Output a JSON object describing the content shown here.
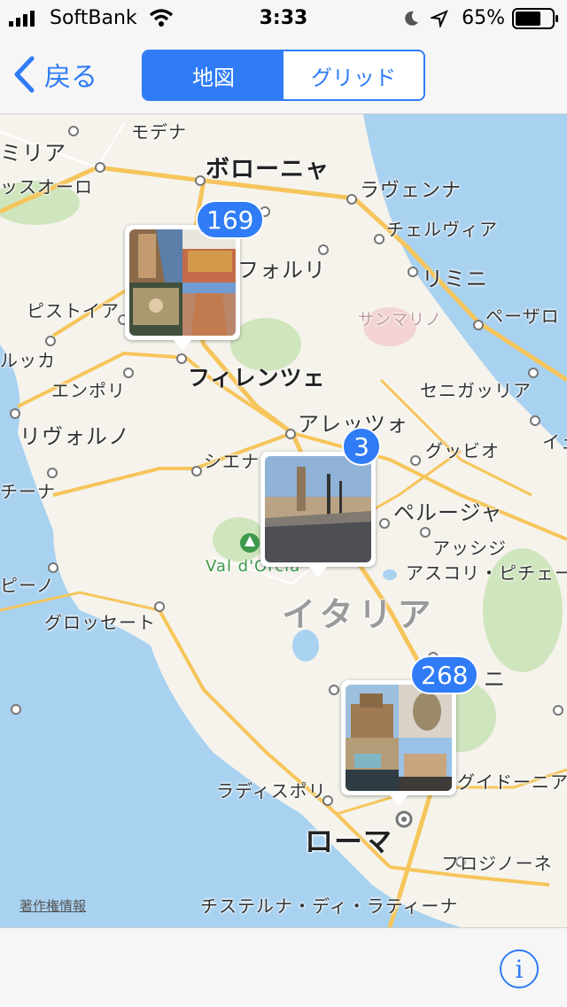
{
  "status": {
    "carrier": "SoftBank",
    "time": "3:33",
    "battery": "65%"
  },
  "nav": {
    "back_label": "戻る",
    "segments": [
      "地図",
      "グリッド"
    ],
    "selected_segment": "地図"
  },
  "map": {
    "labels": {
      "modena": "モデナ",
      "emilia": "ミリア",
      "sassuolo": "ッスオーロ",
      "bologna": "ボローニャ",
      "ravenna": "ラヴェンナ",
      "cervia": "チェルヴィア",
      "forli": "フォルリ",
      "rimini": "リミニ",
      "pistoia": "ピストイア",
      "sanmarino": "サンマリノ",
      "pesaro": "ペーザロ",
      "lucca": "ルッカ",
      "empoli": "エンポリ",
      "firenze": "フィレンツェ",
      "senigallia": "セニガッリア",
      "arezzo": "アレッツォ",
      "livorno": "リヴォルノ",
      "gubbio": "グッビオ",
      "siena": "シエナ",
      "ie": "イェ",
      "cina": "チーナ",
      "perugia": "ペルージャ",
      "assisi": "アッシジ",
      "valdorcia": "Val d'Orcia",
      "ascoli": "アスコリ・ピチェー",
      "pino": "ピーノ",
      "italy": "イタリア",
      "grosseto": "グロッセート",
      "terni": "ニ",
      "guidonia": "グイドーニア",
      "ladispoli": "ラディスポリ",
      "roma": "ローマ",
      "frosinone": "フロジノーネ",
      "cisterna": "チステルナ・ディ・ラティーナ"
    },
    "pins": [
      {
        "count": "169",
        "area": "フィレンツェ"
      },
      {
        "count": "3",
        "area": "Val d'Orcia"
      },
      {
        "count": "268",
        "area": "ローマ"
      }
    ],
    "legal_label": "著作権情報"
  },
  "colors": {
    "accent": "#2f7cf6",
    "sea": "#a9d2f1",
    "land": "#f5f3ec",
    "road": "#f6c55b",
    "park": "#cfe5bd"
  },
  "toolbar": {
    "info_icon": "i"
  }
}
